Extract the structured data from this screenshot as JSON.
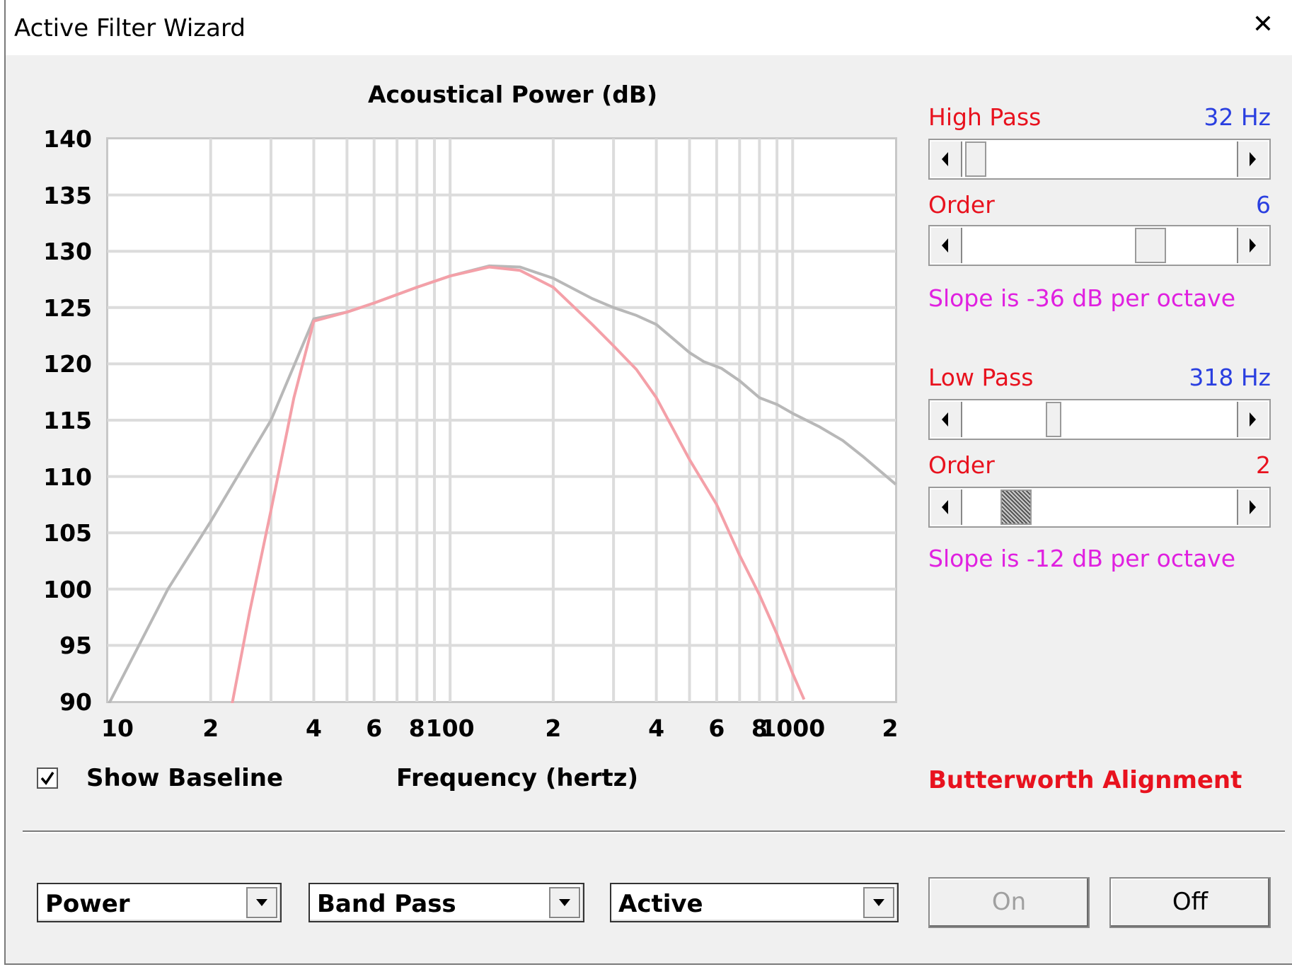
{
  "window": {
    "title": "Active Filter Wizard",
    "close_symbol": "✕"
  },
  "chart_data": {
    "type": "line",
    "title": "Acoustical Power (dB)",
    "xlabel": "Frequency (hertz)",
    "ylabel": "",
    "x_scale": "log",
    "xlim": [
      10,
      2000
    ],
    "ylim": [
      90,
      140
    ],
    "yticks": [
      "140",
      "135",
      "130",
      "125",
      "120",
      "115",
      "110",
      "105",
      "100",
      "95",
      "90"
    ],
    "xticks": [
      {
        "value": 10,
        "label": "10"
      },
      {
        "value": 20,
        "label": "2"
      },
      {
        "value": 40,
        "label": "4"
      },
      {
        "value": 60,
        "label": "6"
      },
      {
        "value": 80,
        "label": "8"
      },
      {
        "value": 100,
        "label": "100"
      },
      {
        "value": 200,
        "label": "2"
      },
      {
        "value": 400,
        "label": "4"
      },
      {
        "value": 600,
        "label": "6"
      },
      {
        "value": 800,
        "label": "8"
      },
      {
        "value": 1000,
        "label": "1000"
      },
      {
        "value": 2000,
        "label": "2"
      }
    ],
    "grid": true,
    "series": [
      {
        "color": "#b8b8b8",
        "points": [
          [
            10,
            89.6
          ],
          [
            15,
            100
          ],
          [
            20,
            106
          ],
          [
            30,
            115
          ],
          [
            40,
            124
          ],
          [
            50,
            124.6
          ],
          [
            60,
            125.4
          ],
          [
            80,
            126.8
          ],
          [
            100,
            127.8
          ],
          [
            130,
            128.7
          ],
          [
            160,
            128.6
          ],
          [
            200,
            127.6
          ],
          [
            260,
            125.8
          ],
          [
            300,
            125
          ],
          [
            350,
            124.3
          ],
          [
            400,
            123.5
          ],
          [
            500,
            121
          ],
          [
            550,
            120.2
          ],
          [
            620,
            119.6
          ],
          [
            700,
            118.5
          ],
          [
            800,
            117
          ],
          [
            900,
            116.4
          ],
          [
            1000,
            115.6
          ],
          [
            1200,
            114.4
          ],
          [
            1400,
            113.2
          ],
          [
            1600,
            111.8
          ],
          [
            2000,
            109.3
          ]
        ]
      },
      {
        "color": "#f4a0a8",
        "points": [
          [
            23,
            89.5
          ],
          [
            26,
            98
          ],
          [
            30,
            107
          ],
          [
            35,
            117
          ],
          [
            40,
            123.8
          ],
          [
            50,
            124.6
          ],
          [
            60,
            125.4
          ],
          [
            80,
            126.8
          ],
          [
            100,
            127.8
          ],
          [
            130,
            128.6
          ],
          [
            160,
            128.3
          ],
          [
            200,
            126.8
          ],
          [
            260,
            123.5
          ],
          [
            300,
            121.6
          ],
          [
            350,
            119.5
          ],
          [
            400,
            117
          ],
          [
            500,
            111.5
          ],
          [
            600,
            107.5
          ],
          [
            700,
            103
          ],
          [
            800,
            99.5
          ],
          [
            900,
            96
          ],
          [
            1000,
            92.5
          ],
          [
            1080,
            90.2
          ]
        ]
      }
    ]
  },
  "show_baseline": {
    "label": "Show Baseline",
    "checked": true
  },
  "high_pass": {
    "label": "High Pass",
    "value": "32 Hz",
    "position": 0.05
  },
  "high_order": {
    "label": "Order",
    "value": "6",
    "position": 0.72,
    "slope": "Slope is -36 dB per octave"
  },
  "low_pass": {
    "label": "Low Pass",
    "value": "318 Hz",
    "position": 0.3
  },
  "low_order": {
    "label": "Order",
    "value": "2",
    "position": 0.18,
    "slope": "Slope is -12 dB per octave"
  },
  "alignment": "Butterworth Alignment",
  "dropdowns": {
    "measure": "Power",
    "filter_type": "Band Pass",
    "mode": "Active"
  },
  "buttons": {
    "on": "On",
    "off": "Off"
  }
}
